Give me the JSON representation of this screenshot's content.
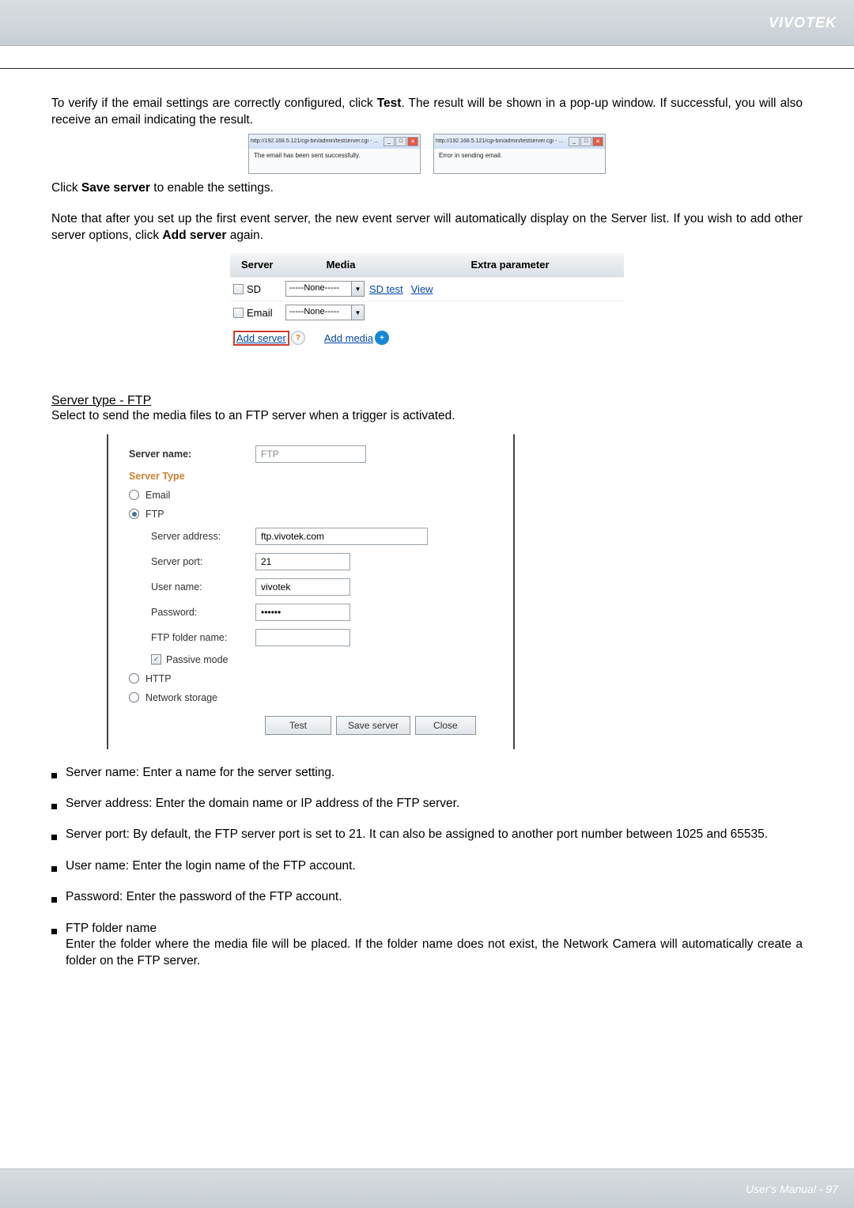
{
  "brand": "VIVOTEK",
  "para1_pre": "To verify if the email settings are correctly configured, click ",
  "para1_bold": "Test",
  "para1_post": ". The result will be shown in a pop-up window. If successful, you will also receive an email indicating the result.",
  "popup_url_success": "http://192.168.5.121/cgi-bin/admin/testserver.cgi - ...",
  "popup_url_error": "http://192.168.5.121/cgi-bin/admin/testserver.cgi - ...",
  "popup_msg_success": "The email has been sent successfully.",
  "popup_msg_error": "Error in sending email.",
  "click_save_pre": "Click ",
  "click_save_bold": "Save server",
  "click_save_post": " to enable the settings.",
  "note_para_pre": "Note that after you set up the first event server, the new event server will automatically display on the Server list.  If you wish to add other server options, click ",
  "note_para_bold": "Add server",
  "note_para_post": " again.",
  "server_list": {
    "h1": "Server",
    "h2": "Media",
    "h3": "Extra parameter",
    "row_sd": {
      "label": "SD",
      "media": "-----None-----",
      "sd_test": "SD test",
      "view": "View"
    },
    "row_email": {
      "label": "Email",
      "media": "-----None-----"
    },
    "add_server": "Add server",
    "add_media": "Add media"
  },
  "section_ftp_title": "Server type - FTP",
  "section_ftp_desc": "Select to send the media files to an FTP server when a trigger is activated.",
  "ftp": {
    "server_name_label": "Server name:",
    "server_name_value": "FTP",
    "server_type_heading": "Server Type",
    "opt_email": "Email",
    "opt_ftp": "FTP",
    "opt_http": "HTTP",
    "opt_ns": "Network storage",
    "addr_label": "Server address:",
    "addr_value": "ftp.vivotek.com",
    "port_label": "Server port:",
    "port_value": "21",
    "user_label": "User name:",
    "user_value": "vivotek",
    "pass_label": "Password:",
    "pass_value": "••••••",
    "folder_label": "FTP folder name:",
    "folder_value": "",
    "passive": "Passive mode",
    "btn_test": "Test",
    "btn_save": "Save server",
    "btn_close": "Close"
  },
  "bullets": {
    "b1": "Server name: Enter a name for the server setting.",
    "b2": "Server address: Enter the domain name or IP address of the FTP server.",
    "b3": "Server port: By default, the FTP server port is set to 21. It can also be assigned to another port number between 1025 and 65535.",
    "b4": "User name: Enter the login name of the FTP account.",
    "b5": "Password: Enter the password of the FTP account.",
    "b6_line1": "FTP folder name",
    "b6_line2": "Enter the folder where the media file will be placed. If the folder name does not exist, the Network Camera will automatically create a folder on the FTP server."
  },
  "footer_text": "User's Manual - 97"
}
